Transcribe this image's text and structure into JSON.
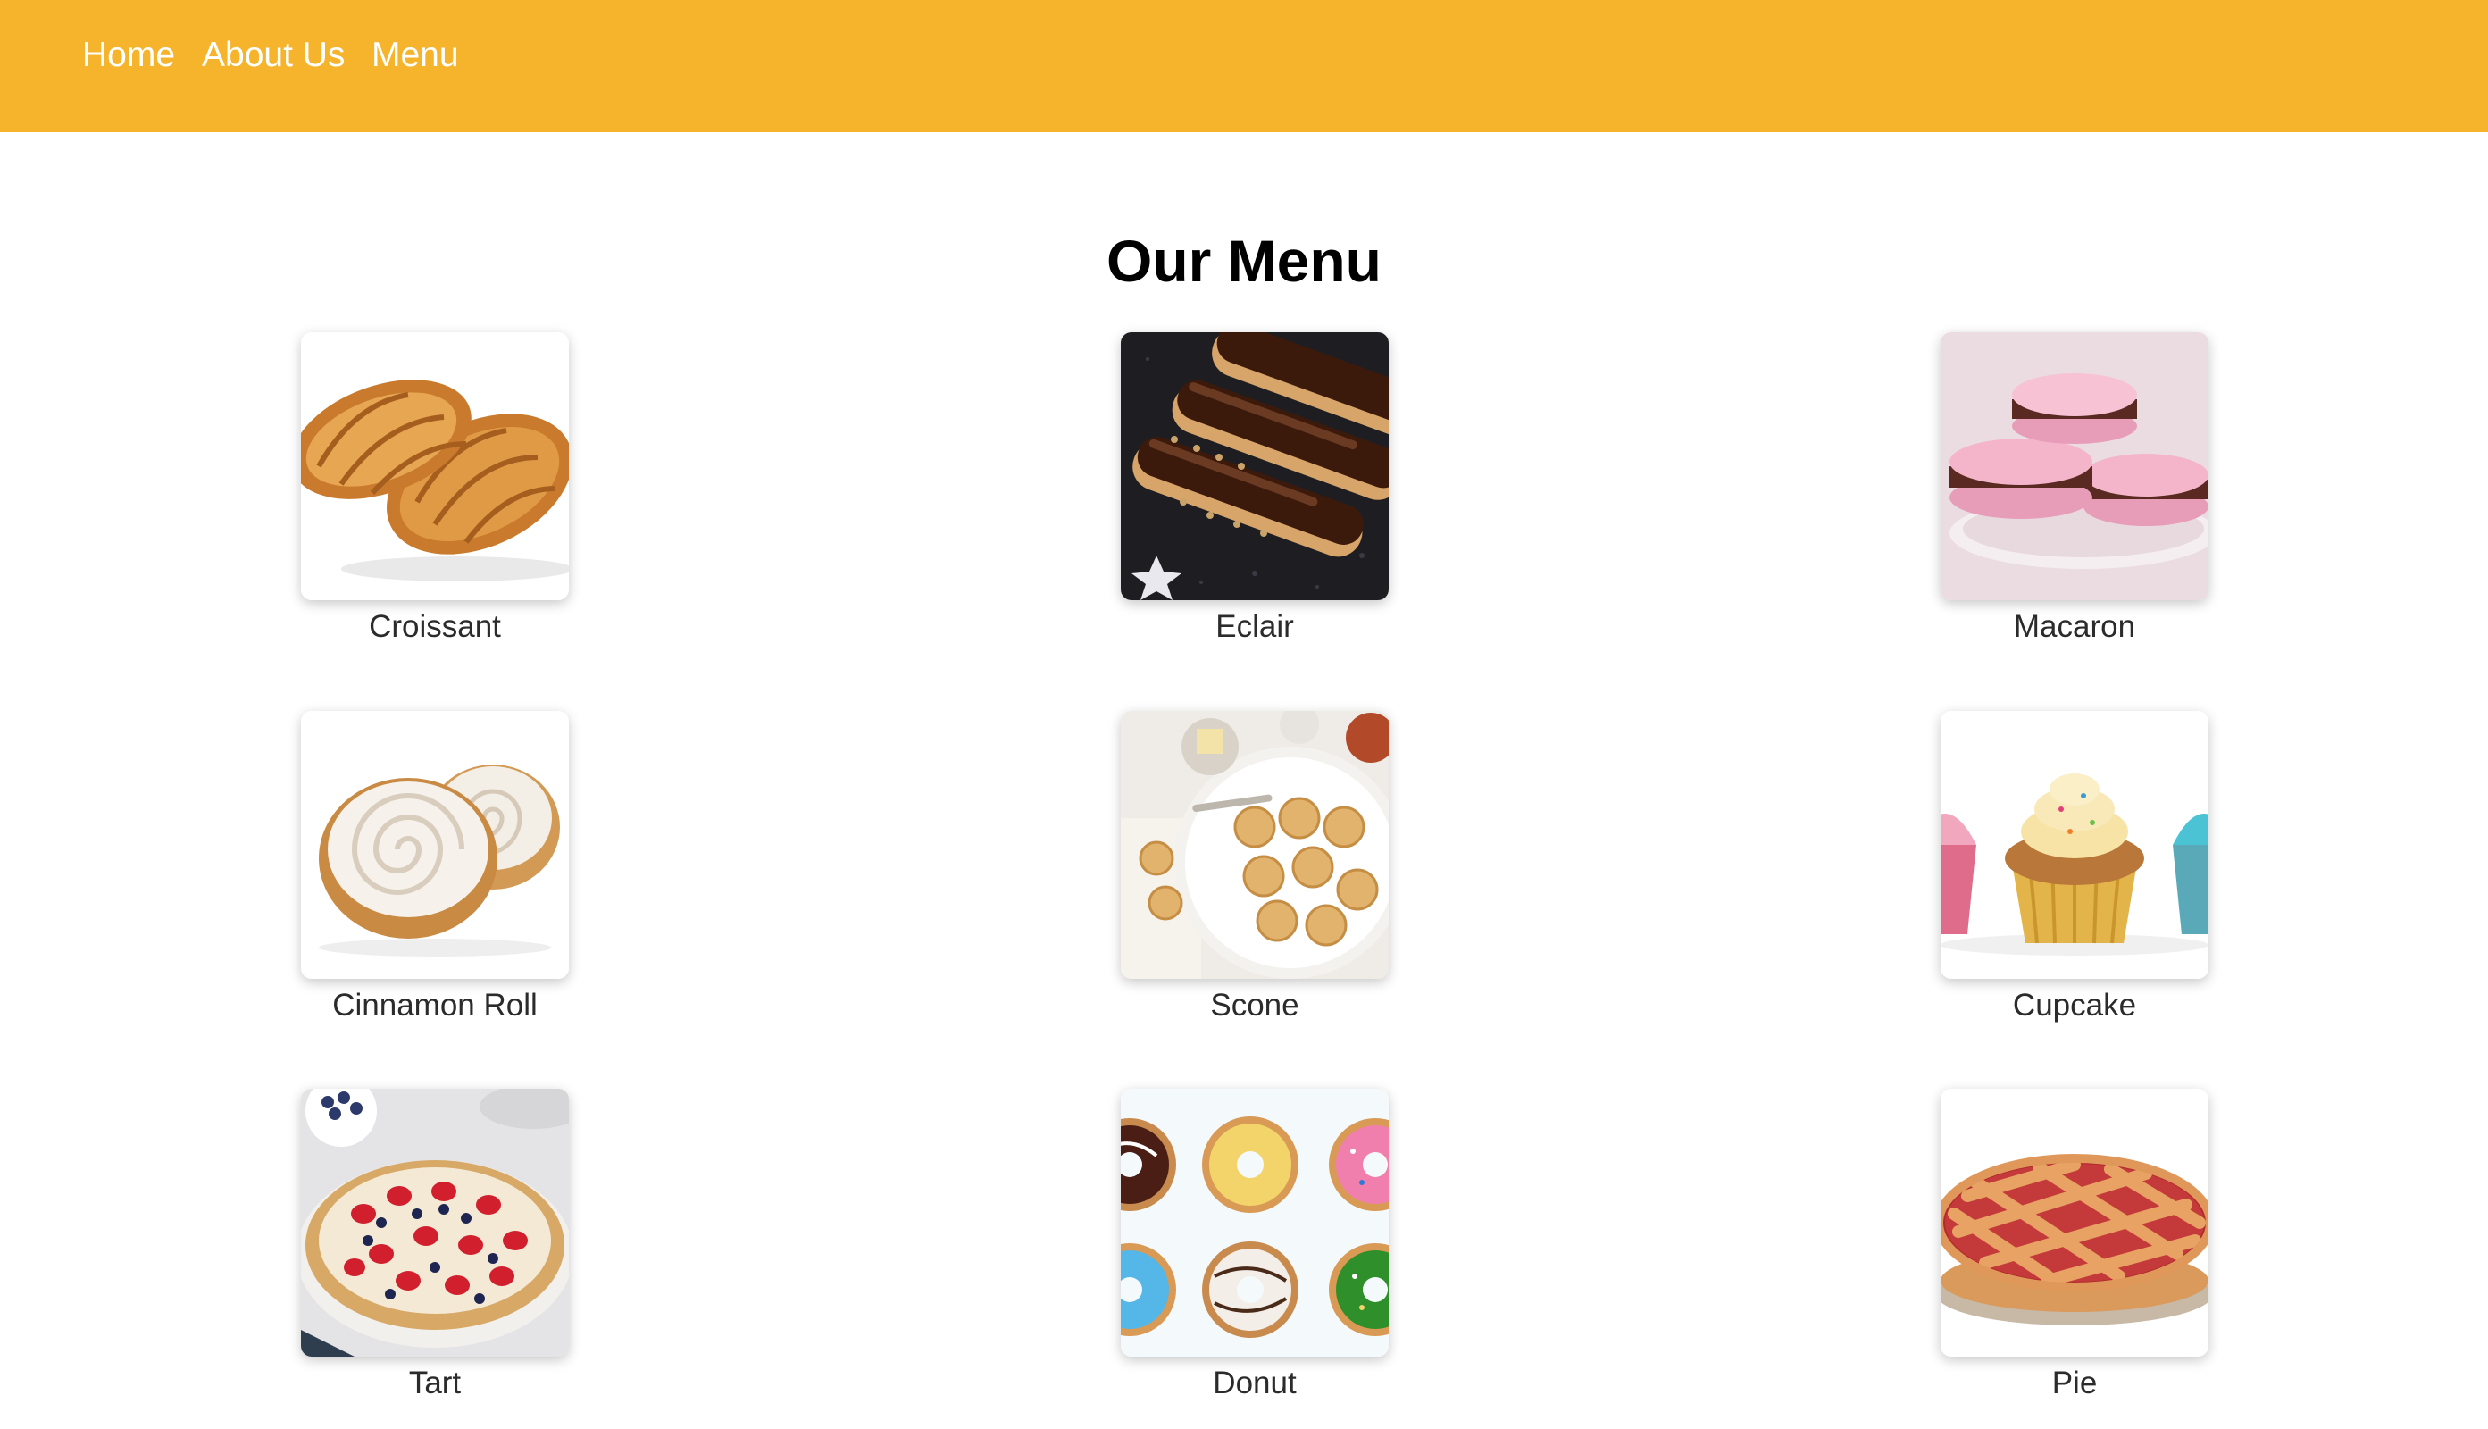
{
  "nav": {
    "items": [
      {
        "label": "Home"
      },
      {
        "label": "About Us"
      },
      {
        "label": "Menu"
      }
    ],
    "background": "#F6B42C"
  },
  "main": {
    "title": "Our Menu",
    "items": [
      {
        "name": "Croissant",
        "icon": "croissant-image"
      },
      {
        "name": "Eclair",
        "icon": "eclair-image"
      },
      {
        "name": "Macaron",
        "icon": "macaron-image"
      },
      {
        "name": "Cinnamon Roll",
        "icon": "cinnamon-roll-image"
      },
      {
        "name": "Scone",
        "icon": "scone-image"
      },
      {
        "name": "Cupcake",
        "icon": "cupcake-image"
      },
      {
        "name": "Tart",
        "icon": "tart-image"
      },
      {
        "name": "Donut",
        "icon": "donut-image"
      },
      {
        "name": "Pie",
        "icon": "pie-image"
      }
    ]
  }
}
